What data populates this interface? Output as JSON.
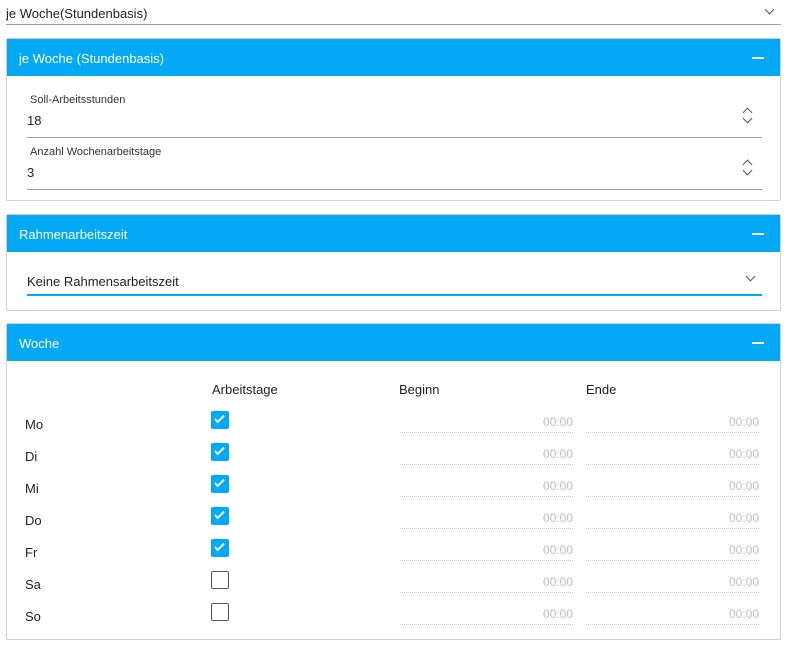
{
  "top_select": {
    "value": "je Woche(Stundenbasis)"
  },
  "panel_hours": {
    "title": "je Woche (Stundenbasis)",
    "fields": [
      {
        "label": "Soll-Arbeitsstunden",
        "value": "18"
      },
      {
        "label": "Anzahl Wochenarbeitstage",
        "value": "3"
      }
    ]
  },
  "panel_rahmen": {
    "title": "Rahmenarbeitszeit",
    "select_value": "Keine Rahmensarbeitszeit"
  },
  "panel_week": {
    "title": "Woche",
    "columns": {
      "workdays": "Arbeitstage",
      "begin": "Beginn",
      "end": "Ende"
    },
    "days": [
      {
        "label": "Mo",
        "checked": true,
        "begin": "00:00",
        "end": "00:00"
      },
      {
        "label": "Di",
        "checked": true,
        "begin": "00:00",
        "end": "00:00"
      },
      {
        "label": "Mi",
        "checked": true,
        "begin": "00:00",
        "end": "00:00"
      },
      {
        "label": "Do",
        "checked": true,
        "begin": "00:00",
        "end": "00:00"
      },
      {
        "label": "Fr",
        "checked": true,
        "begin": "00:00",
        "end": "00:00"
      },
      {
        "label": "Sa",
        "checked": false,
        "begin": "00:00",
        "end": "00:00"
      },
      {
        "label": "So",
        "checked": false,
        "begin": "00:00",
        "end": "00:00"
      }
    ]
  },
  "colors": {
    "accent": "#03a9f4"
  }
}
